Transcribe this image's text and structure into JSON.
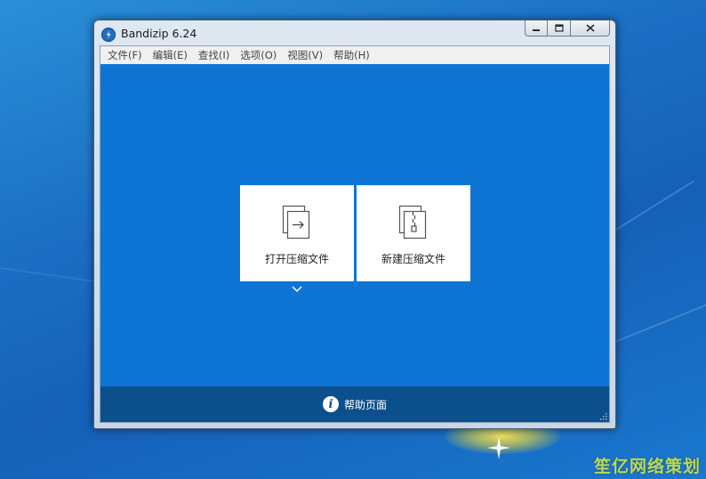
{
  "window": {
    "title": "Bandizip 6.24"
  },
  "menu": {
    "items": [
      {
        "label": "文件(F)"
      },
      {
        "label": "编辑(E)"
      },
      {
        "label": "查找(I)"
      },
      {
        "label": "选项(O)"
      },
      {
        "label": "视图(V)"
      },
      {
        "label": "帮助(H)"
      }
    ]
  },
  "main": {
    "open_archive_label": "打开压缩文件",
    "new_archive_label": "新建压缩文件"
  },
  "footer": {
    "help_label": "帮助页面",
    "help_icon_glyph": "i"
  },
  "desktop": {
    "watermark": "笙亿网络策划"
  },
  "colors": {
    "client_blue": "#0f75d5",
    "footer_blue": "#0b4f8c"
  }
}
